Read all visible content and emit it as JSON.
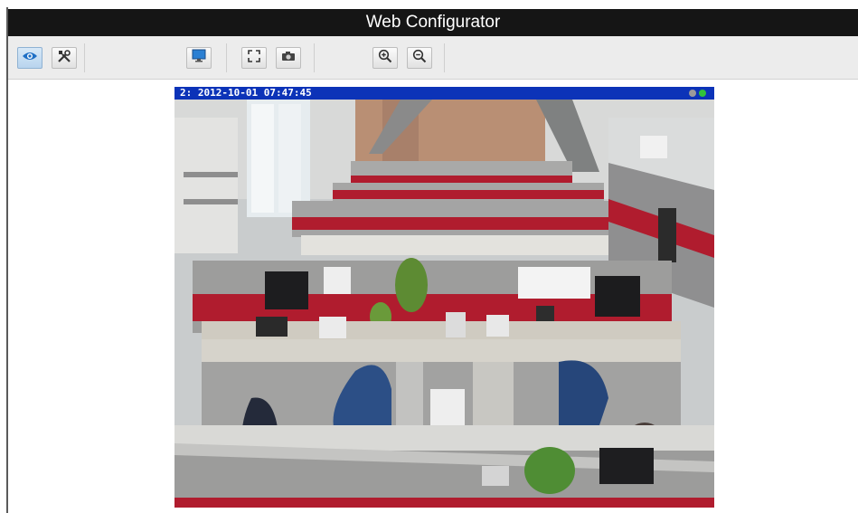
{
  "window": {
    "title": "Web Configurator"
  },
  "toolbar": {
    "buttons": [
      {
        "icon": "eye-icon",
        "state": "active"
      },
      {
        "icon": "tools-icon",
        "state": "normal"
      },
      {
        "icon": "monitor-icon",
        "state": "normal"
      },
      {
        "icon": "fullscreen-icon",
        "state": "normal"
      },
      {
        "icon": "camera-icon",
        "state": "normal"
      },
      {
        "icon": "zoom-in-icon",
        "state": "normal"
      },
      {
        "icon": "zoom-out-icon",
        "state": "normal"
      }
    ]
  },
  "video": {
    "overlay_label": "2:  2012-10-01 07:47:45",
    "status_colors": [
      "#9a9a9a",
      "#31c23a"
    ]
  },
  "colors": {
    "title_bar": "#151515",
    "video_bar": "#0c33b8",
    "accent_red": "#b01c2e"
  }
}
